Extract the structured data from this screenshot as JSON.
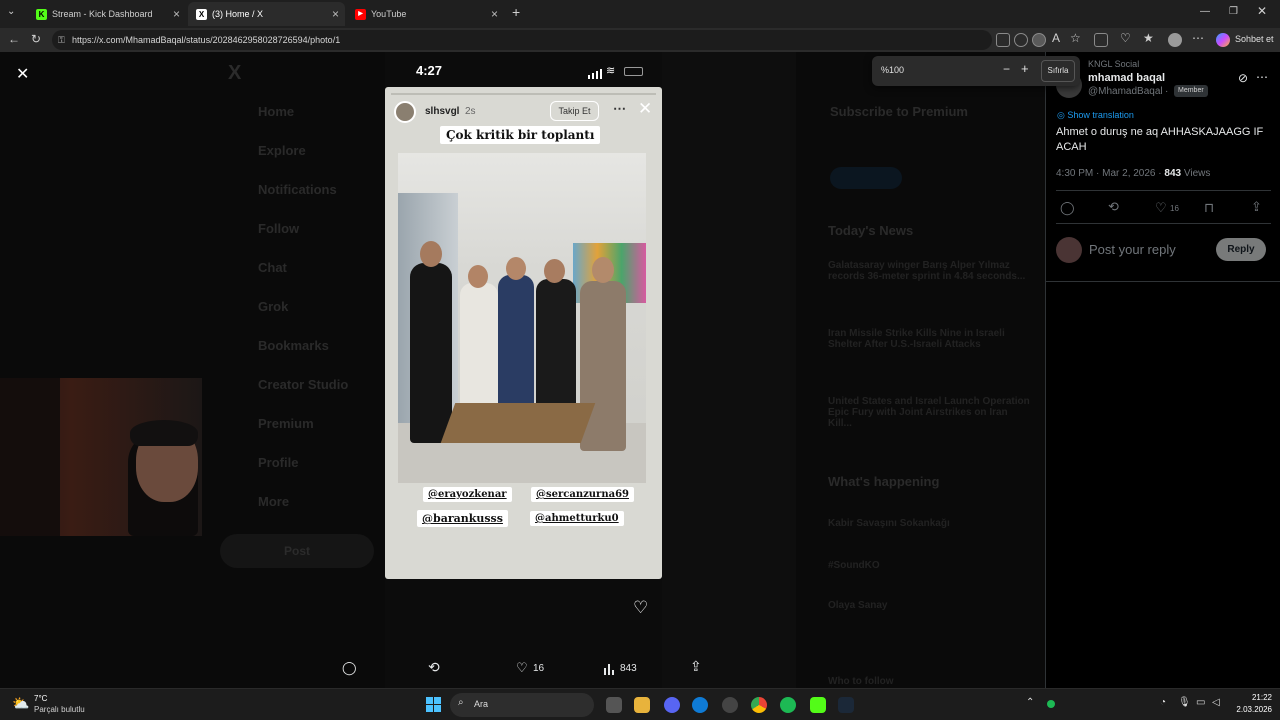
{
  "browser": {
    "tabs": [
      {
        "title": "Stream - Kick Dashboard",
        "favicon": "kick-icon",
        "color": "#53fc18"
      },
      {
        "title": "(3) Home / X",
        "favicon": "x-icon",
        "color": "#ffffff"
      },
      {
        "title": "YouTube",
        "favicon": "youtube-icon",
        "color": "#ff0000"
      }
    ],
    "url": "https://x.com/MhamadBaqal/status/2028462958028726594/photo/1",
    "copilot_label": "Sohbet et"
  },
  "zoom": {
    "value": "%100",
    "reset_label": "Sıfırla"
  },
  "story": {
    "time": "4:27",
    "username": "slhsvgl",
    "age": "2s",
    "follow_label": "Takip Et",
    "caption": "Çok kritik bir toplantı",
    "tags": [
      "@erayozkenar",
      "@sercanzurna69",
      "@barankusss",
      "@ahmetturku0"
    ]
  },
  "media_actions": {
    "likes": "16",
    "views": "843"
  },
  "tweet": {
    "community": "KNGL Social",
    "display_name": "mhamad baqal",
    "handle": "@MhamadBaqal",
    "separator": "·",
    "badge": "Member",
    "show_translation": "Show translation",
    "text": "Ahmet o duruş ne aq AHHASKAJAAGG IF ACAH",
    "timestamp": "4:30 PM · Mar 2, 2026 · ",
    "views_count": "843",
    "views_label": " Views",
    "likes": "16",
    "reply_placeholder": "Post your reply",
    "reply_button": "Reply"
  },
  "background_sidebar": [
    "Home",
    "Explore",
    "Notifications",
    "Follow",
    "Chat",
    "Grok",
    "Bookmarks",
    "Creator Studio",
    "Premium",
    "Profile",
    "More",
    "Post"
  ],
  "background_right": {
    "subscribe_title": "Subscribe to Premium",
    "news_title": "Today's News",
    "news": [
      "Galatasaray winger Barış Alper Yılmaz records 36-meter sprint in 4.84 seconds...",
      "Iran Missile Strike Kills Nine in Israeli Shelter After U.S.-Israeli Attacks",
      "United States and Israel Launch Operation Epic Fury with Joint Airstrikes on Iran Kill..."
    ],
    "happening_title": "What's happening",
    "trends": [
      "Kabir Savaşını Sokankağı",
      "#SoundKO",
      "Olaya Sanay"
    ],
    "who_to_follow": "Who to follow"
  },
  "taskbar": {
    "weather_temp": "7°C",
    "weather_desc": "Parçalı bulutlu",
    "search_label": "Ara",
    "time": "21:22",
    "date": "2.03.2026"
  }
}
